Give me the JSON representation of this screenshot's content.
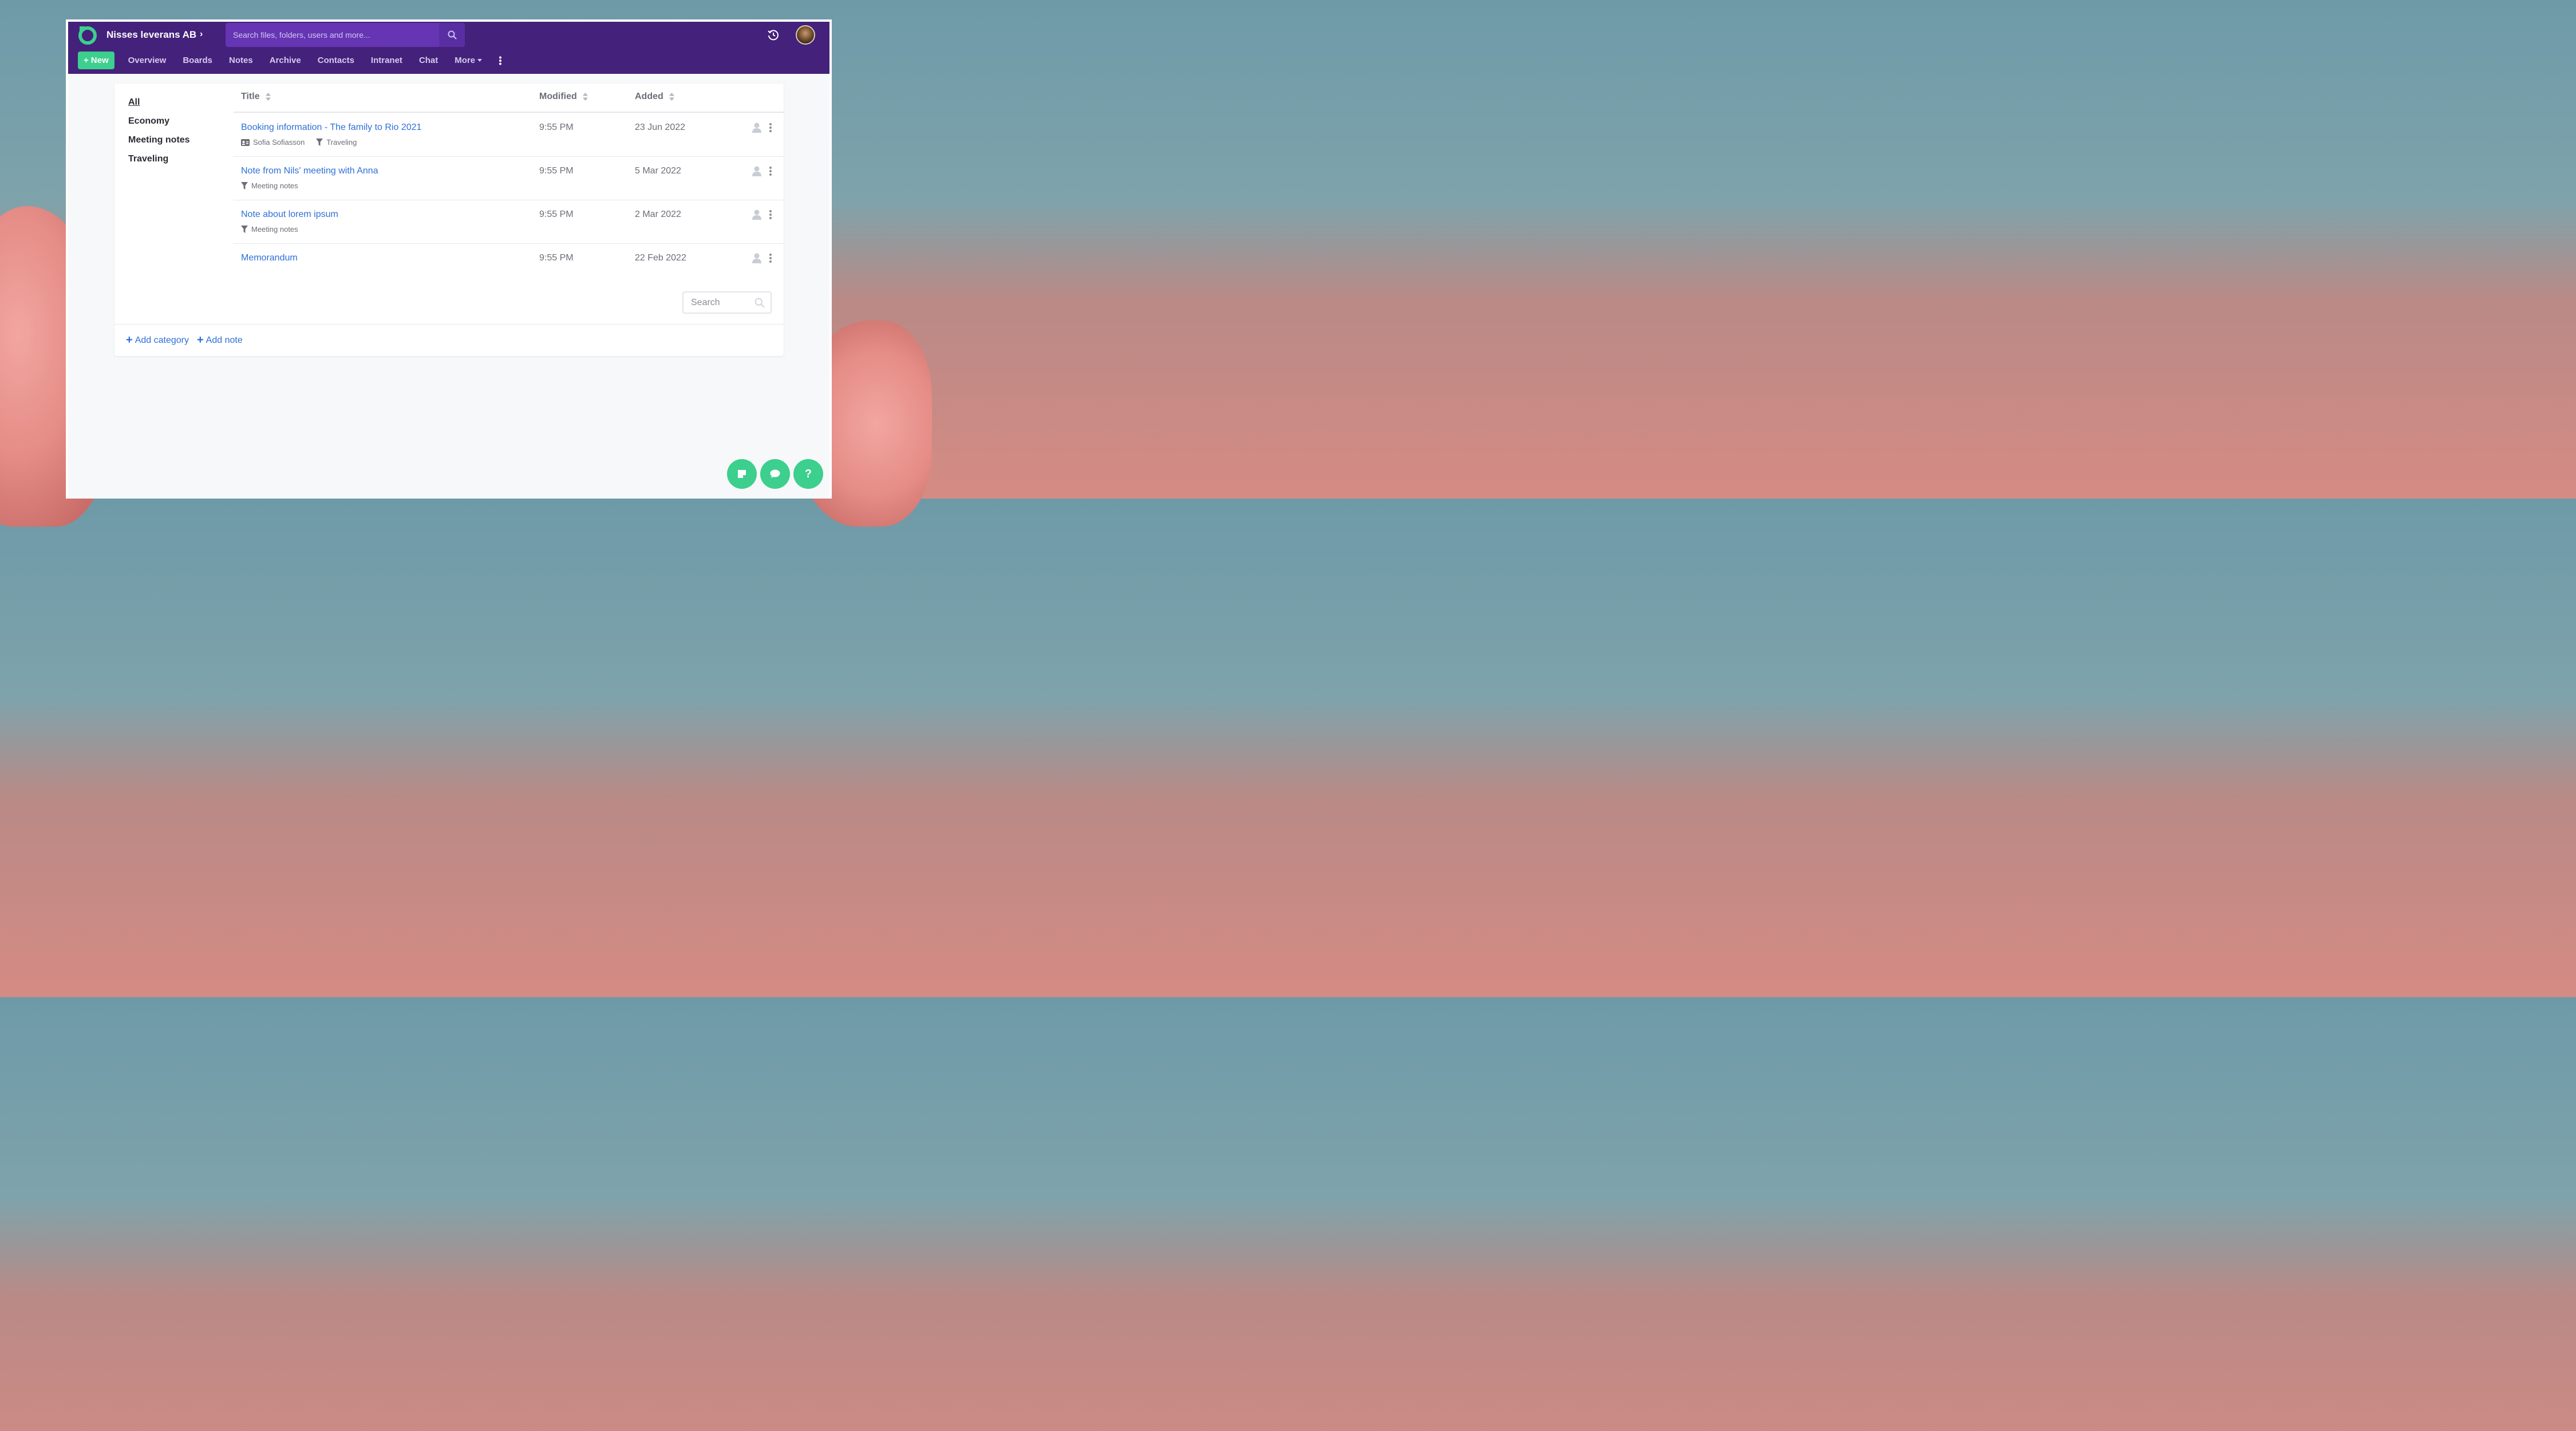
{
  "app": {
    "company": "Nisses leverans AB",
    "search_placeholder": "Search files, folders, users and more..."
  },
  "nav": {
    "new_label": "New",
    "items": [
      "Overview",
      "Boards",
      "Notes",
      "Archive",
      "Contacts",
      "Intranet",
      "Chat"
    ],
    "more_label": "More"
  },
  "categories": [
    "All",
    "Economy",
    "Meeting notes",
    "Traveling"
  ],
  "table": {
    "headers": {
      "title": "Title",
      "modified": "Modified",
      "added": "Added"
    },
    "rows": [
      {
        "title": "Booking information - The family to Rio 2021",
        "contact": "Sofia Sofiasson",
        "category": "Traveling",
        "modified": "9:55 PM",
        "added": "23 Jun 2022"
      },
      {
        "title": "Note from Nils' meeting with Anna",
        "contact": "",
        "category": "Meeting notes",
        "modified": "9:55 PM",
        "added": "5 Mar 2022"
      },
      {
        "title": "Note about lorem ipsum",
        "contact": "",
        "category": "Meeting notes",
        "modified": "9:55 PM",
        "added": "2 Mar 2022"
      },
      {
        "title": "Memorandum",
        "contact": "",
        "category": "",
        "modified": "9:55 PM",
        "added": "22 Feb 2022"
      }
    ],
    "search_placeholder": "Search"
  },
  "footer": {
    "add_category": "Add category",
    "add_note": "Add note"
  },
  "fab": {
    "help_label": "?"
  },
  "colors": {
    "brand": "#44217a",
    "accent": "#3ccf8e",
    "link": "#2e6fd6"
  },
  "icons": [
    "logo-icon",
    "chevron-right-icon",
    "search-icon",
    "history-icon",
    "avatar",
    "plus-icon",
    "caret-down-icon",
    "kebab-icon",
    "sort-icon",
    "contact-card-icon",
    "filter-icon",
    "person-icon",
    "note-icon",
    "chat-icon",
    "help-icon"
  ]
}
